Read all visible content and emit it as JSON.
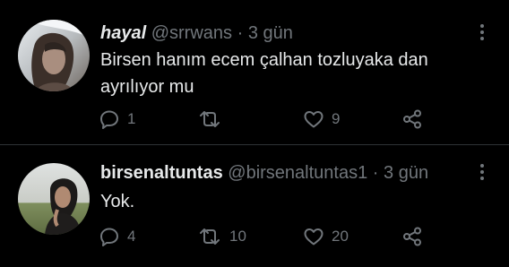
{
  "tweets": [
    {
      "name": "hayal",
      "handle": "@srrwans",
      "separator": "·",
      "time": "3 gün",
      "text": "Birsen hanım ecem çalhan tozluyaka dan ayrılıyor mu",
      "replies": "1",
      "retweets": "",
      "likes": "9"
    },
    {
      "name": "birsenaltuntas",
      "handle": "@birsenaltuntas1",
      "separator": "·",
      "time": "3 gün",
      "text": "Yok.",
      "replies": "4",
      "retweets": "10",
      "likes": "20"
    }
  ],
  "icons": {
    "reply": "reply-icon",
    "retweet": "retweet-icon",
    "like": "heart-icon",
    "share": "share-icon",
    "more": "more-vertical-icon"
  },
  "colors": {
    "background": "#000000",
    "text": "#e7e9ea",
    "secondary": "#71767b",
    "divider": "#2f3336"
  }
}
